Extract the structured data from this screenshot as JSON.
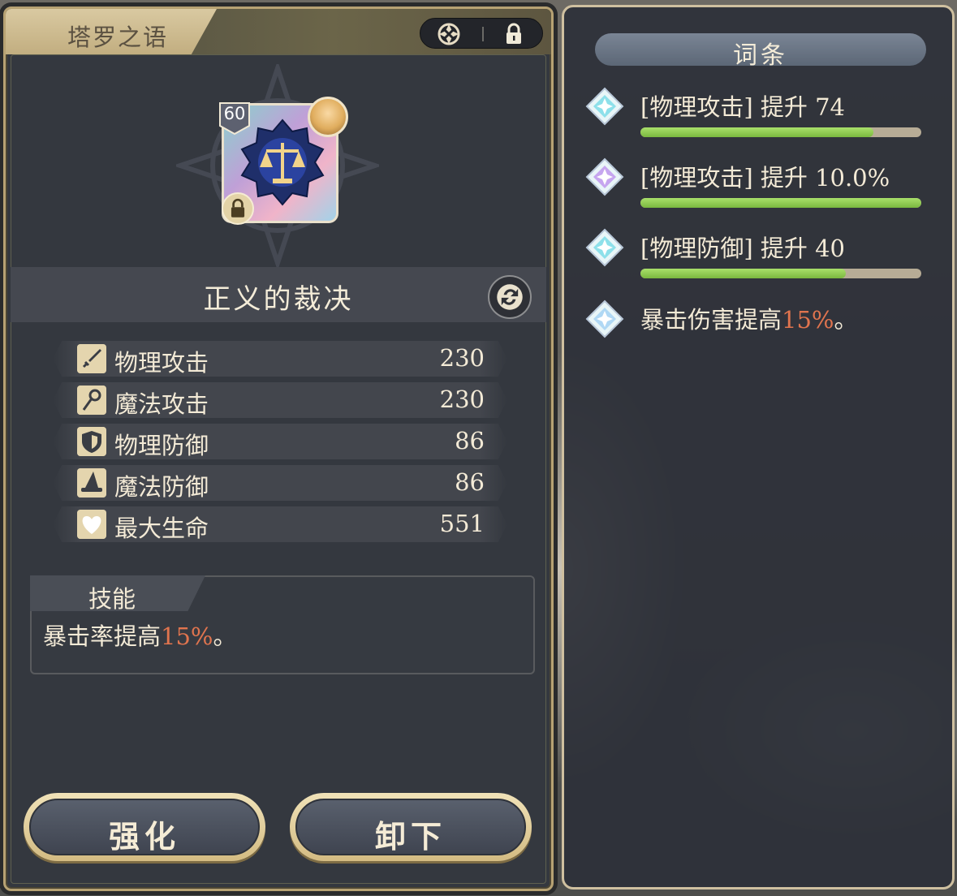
{
  "left_panel": {
    "title": "塔罗之语",
    "header_icons": [
      "close-icon",
      "lock-icon"
    ],
    "card": {
      "level": "60"
    },
    "item_name": "正义的裁决",
    "stats": [
      {
        "icon": "sword-icon",
        "label": "物理攻击",
        "value": "230"
      },
      {
        "icon": "staff-icon",
        "label": "魔法攻击",
        "value": "230"
      },
      {
        "icon": "shield-icon",
        "label": "物理防御",
        "value": "86"
      },
      {
        "icon": "wizard-hat-icon",
        "label": "魔法防御",
        "value": "86"
      },
      {
        "icon": "heart-icon",
        "label": "最大生命",
        "value": "551"
      }
    ],
    "skill": {
      "title": "技能",
      "desc_prefix": "暴击率提高",
      "desc_highlight": "15%",
      "desc_suffix": "。"
    },
    "buttons": {
      "enhance": "强化",
      "unequip": "卸下"
    }
  },
  "right_panel": {
    "title": "词条",
    "affixes": [
      {
        "text": "[物理攻击] 提升 74",
        "progress": 0.83
      },
      {
        "text": "[物理攻击] 提升 10.0%",
        "progress": 1.0
      },
      {
        "text": "[物理防御] 提升 40",
        "progress": 0.73
      }
    ],
    "special_affix": {
      "prefix": "暴击伤害提高",
      "highlight": "15%",
      "suffix": "。"
    }
  },
  "colors": {
    "panel_bg": "#34383f",
    "gold_border": "#b7a273",
    "highlight": "#e0744e",
    "bar_fill": "#8fcb52",
    "bar_track": "#b7ac96"
  }
}
